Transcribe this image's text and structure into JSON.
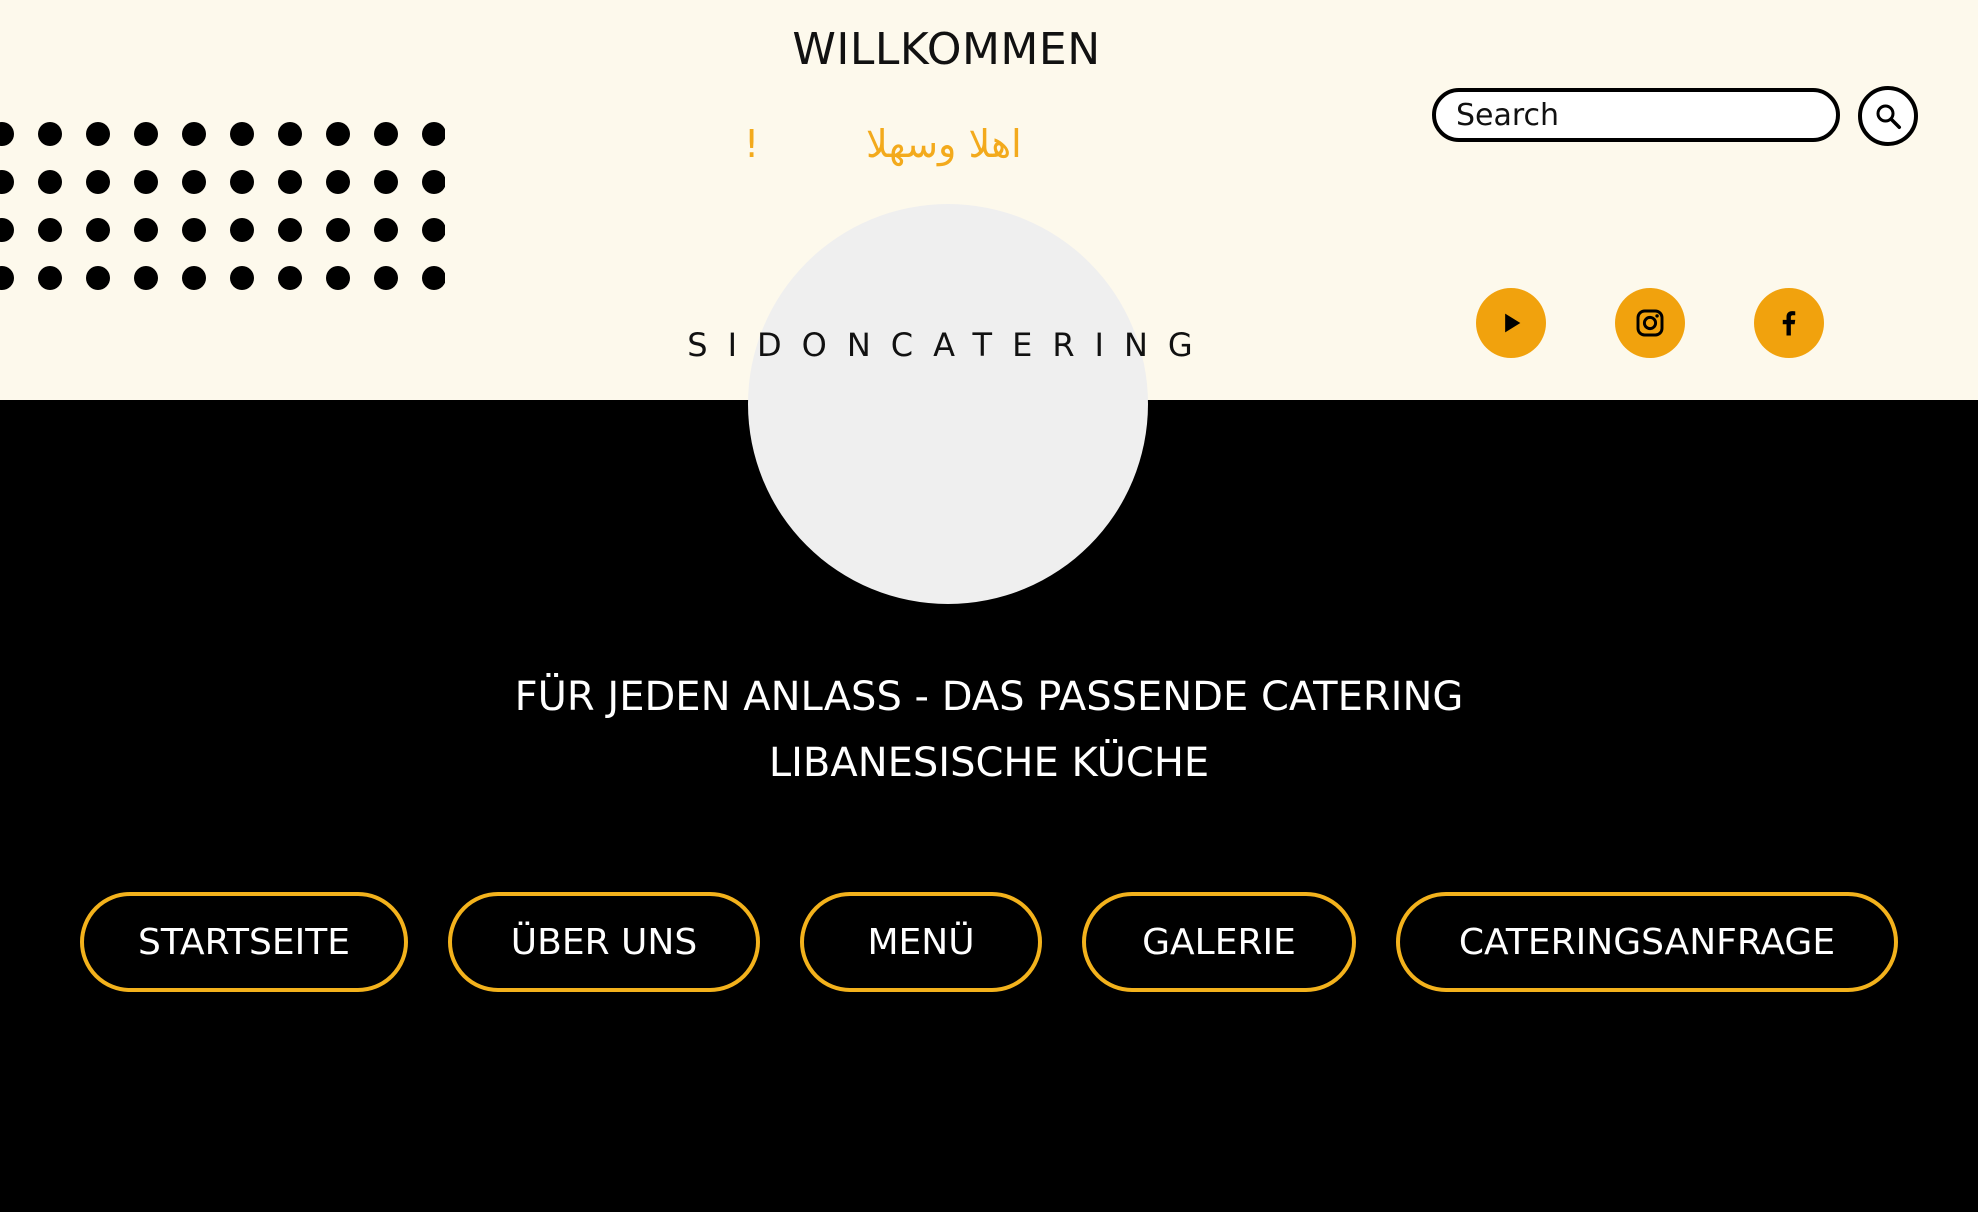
{
  "header": {
    "welcome": "WILLKOMMEN",
    "arabic_greeting": "اهلا وسهلا",
    "arabic_exclamation": "!",
    "brand": "SIDONCATERING"
  },
  "search": {
    "placeholder": "Search",
    "button_icon": "search-icon"
  },
  "social": [
    {
      "name": "YouTube",
      "icon": "play-icon"
    },
    {
      "name": "Instagram",
      "icon": "instagram-icon"
    },
    {
      "name": "Facebook",
      "icon": "facebook-icon"
    }
  ],
  "hero": {
    "line1": "FÜR JEDEN ANLASS - DAS PASSENDE CATERING",
    "line2": "LIBANESISCHE KÜCHE"
  },
  "nav": {
    "items": [
      {
        "label": "STARTSEITE"
      },
      {
        "label": "ÜBER UNS"
      },
      {
        "label": "MENÜ"
      },
      {
        "label": "GALERIE"
      },
      {
        "label": "CATERINGSANFRAGE"
      }
    ]
  },
  "colors": {
    "header_bg": "#fdf9ec",
    "body_bg": "#000000",
    "accent": "#f1a20d",
    "button_border": "#f3b21c",
    "logo_circle": "#efefef"
  }
}
